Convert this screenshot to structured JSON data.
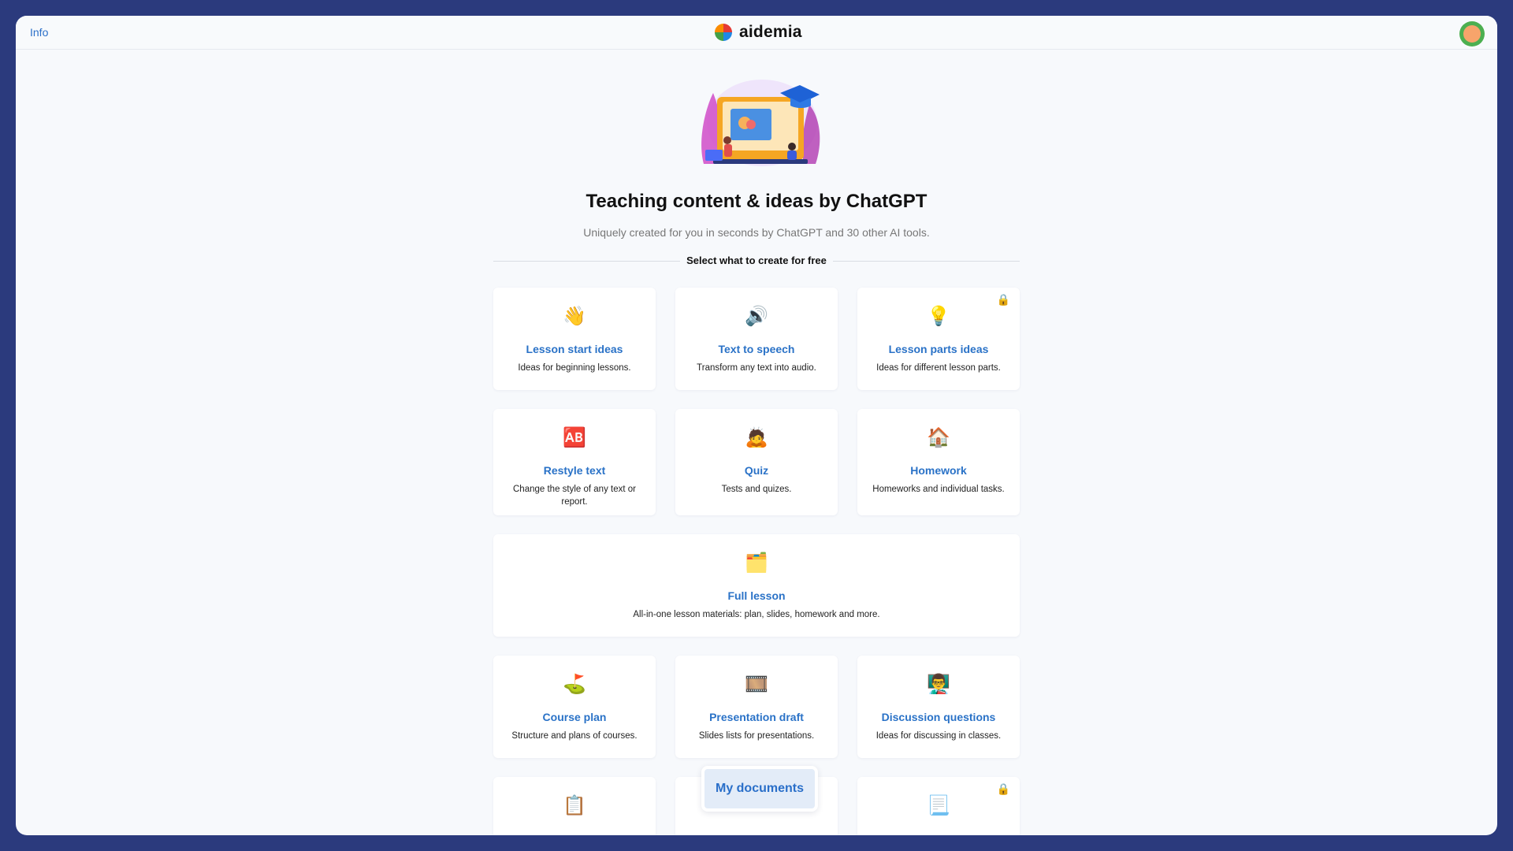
{
  "header": {
    "info_link": "Info",
    "brand": "aidemia"
  },
  "hero": {
    "title": "Teaching content & ideas by ChatGPT",
    "subtitle": "Uniquely created for you in seconds by ChatGPT and 30 other AI tools.",
    "section_label": "Select what to create for free"
  },
  "cards": [
    {
      "emoji": "👋",
      "label": "Lesson start ideas",
      "desc": "Ideas for beginning lessons.",
      "locked": false
    },
    {
      "emoji": "🔊",
      "label": "Text to speech",
      "desc": "Transform any text into audio.",
      "locked": false
    },
    {
      "emoji": "💡",
      "label": "Lesson parts ideas",
      "desc": "Ideas for different lesson parts.",
      "locked": true
    },
    {
      "emoji": "🆎",
      "label": "Restyle text",
      "desc": "Change the style of any text or report.",
      "locked": false
    },
    {
      "emoji": "🙇",
      "label": "Quiz",
      "desc": "Tests and quizes.",
      "locked": false
    },
    {
      "emoji": "🏠",
      "label": "Homework",
      "desc": "Homeworks and individual tasks.",
      "locked": false
    },
    {
      "emoji": "🗂️",
      "label": "Full lesson",
      "desc": "All-in-one lesson materials: plan, slides, homework and more.",
      "locked": false
    },
    {
      "emoji": "⛳",
      "label": "Course plan",
      "desc": "Structure and plans of courses.",
      "locked": false
    },
    {
      "emoji": "🎞️",
      "label": "Presentation draft",
      "desc": "Slides lists for presentations.",
      "locked": false
    },
    {
      "emoji": "👨‍🏫",
      "label": "Discussion questions",
      "desc": "Ideas for discussing in classes.",
      "locked": false
    },
    {
      "emoji": "📋",
      "label": "",
      "desc": "",
      "locked": false
    },
    {
      "emoji": "⌨️",
      "label": "",
      "desc": "",
      "locked": false
    },
    {
      "emoji": "📃",
      "label": "",
      "desc": "",
      "locked": true
    }
  ],
  "lock_icon": "🔒",
  "floating": {
    "my_documents": "My documents"
  }
}
